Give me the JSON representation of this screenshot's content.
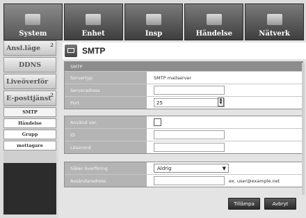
{
  "nav": {
    "tabs": [
      {
        "label": "System",
        "icon": "monitor-icon"
      },
      {
        "label": "Enhet",
        "icon": "camera-icon"
      },
      {
        "label": "Insp",
        "icon": "record-icon"
      },
      {
        "label": "Händelse",
        "icon": "alarm-icon"
      },
      {
        "label": "Nätverk",
        "icon": "network-icon"
      }
    ]
  },
  "sidebar": {
    "items": [
      {
        "label": "Ansl.läge",
        "sup": "2"
      },
      {
        "label": "DDNS"
      },
      {
        "label": "Liveöverför"
      },
      {
        "label": "E-posttjänst",
        "sup": "2"
      }
    ],
    "subitems": [
      "SMTP",
      "Händelse",
      "Grupp",
      "mottagare"
    ]
  },
  "page": {
    "title": "SMTP"
  },
  "smtp": {
    "header": "SMTP",
    "servertype_label": "Servertyp",
    "servertype_value": "SMTP mailserver",
    "serveraddress_label": "Serveradress",
    "serveraddress_value": "",
    "port_label": "Port",
    "port_value": "25"
  },
  "auth": {
    "use_label": "Använd ver.",
    "id_label": "ID",
    "id_value": "",
    "password_label": "Lösenord",
    "password_value": ""
  },
  "security": {
    "secure_label": "Säker överföring",
    "secure_value": "Aldrig",
    "sender_label": "Avsändaradress",
    "sender_value": "",
    "sender_hint": "ex. user@example.net"
  },
  "buttons": {
    "apply": "Tillämpa",
    "cancel": "Avbryt"
  }
}
